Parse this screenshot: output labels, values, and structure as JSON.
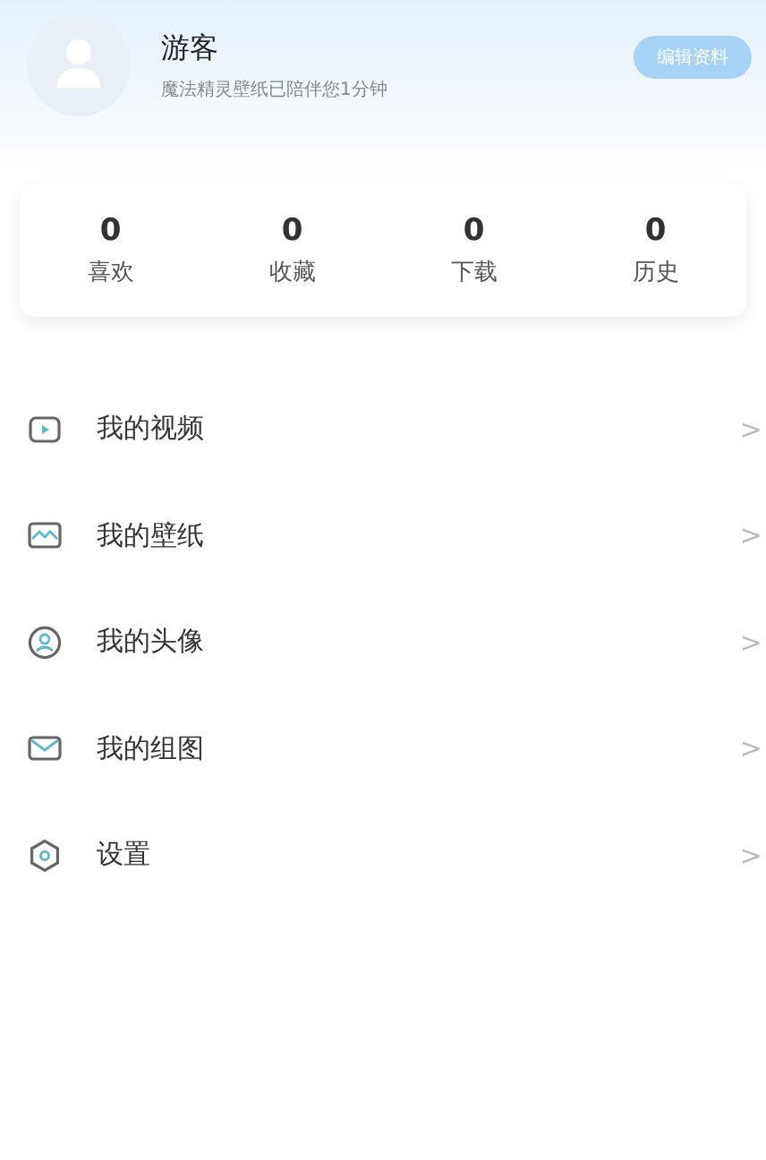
{
  "profile": {
    "name": "游客",
    "subtitle": "魔法精灵壁纸已陪伴您1分钟",
    "edit_button": "编辑资料"
  },
  "stats": [
    {
      "value": "0",
      "label": "喜欢"
    },
    {
      "value": "0",
      "label": "收藏"
    },
    {
      "value": "0",
      "label": "下载"
    },
    {
      "value": "0",
      "label": "历史"
    }
  ],
  "menu": [
    {
      "kind": "video",
      "label": "我的视频",
      "chevron": ">"
    },
    {
      "kind": "wallpaper",
      "label": "我的壁纸",
      "chevron": ">"
    },
    {
      "kind": "avatar",
      "label": "我的头像",
      "chevron": ">"
    },
    {
      "kind": "album",
      "label": "我的组图",
      "chevron": ">"
    },
    {
      "kind": "settings",
      "label": "设置",
      "chevron": ">"
    }
  ]
}
